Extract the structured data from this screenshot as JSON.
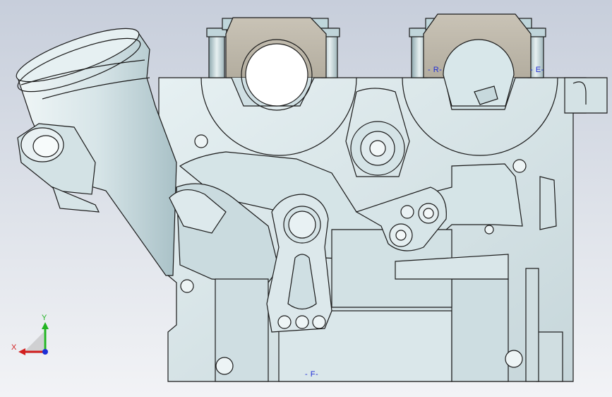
{
  "viewport": {
    "background_top": "#c7cedb",
    "background_bottom": "#f2f3f6",
    "part_fill": "#d9e6e9",
    "edge_color": "#1a1a1a",
    "section_label_color": "#1f2cd6"
  },
  "section_labels": {
    "r": "- R-",
    "e": "- E-",
    "f": "- F-"
  },
  "triad": {
    "x_label": "X",
    "y_label": "Y",
    "x_color": "#d21f1f",
    "y_color": "#22b422",
    "z_color": "#1c2fd6"
  }
}
